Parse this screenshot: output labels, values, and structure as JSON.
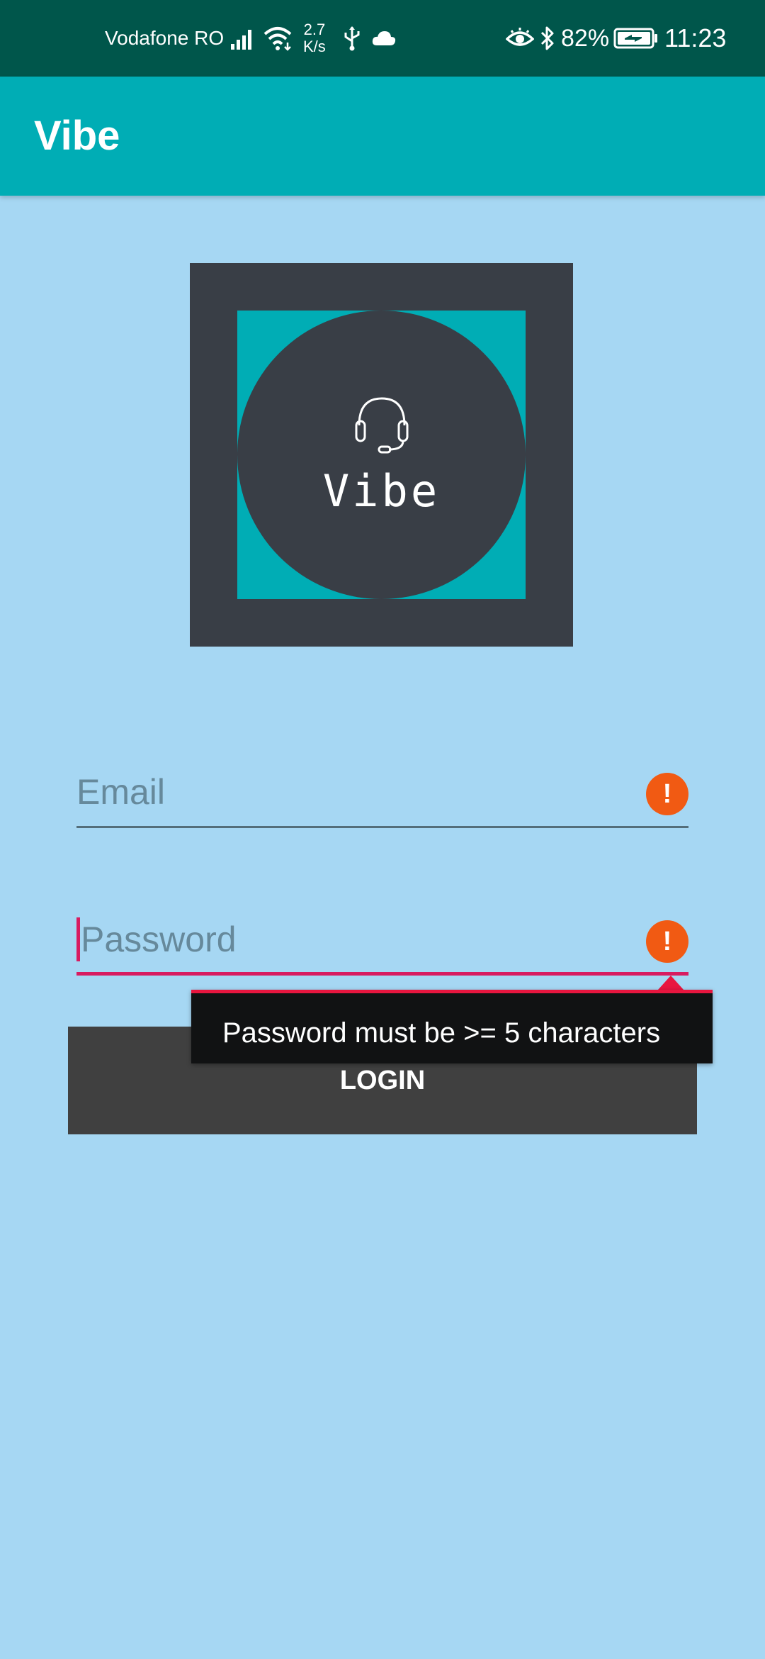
{
  "status_bar": {
    "carrier": "Vodafone RO",
    "net_speed_value": "2.7",
    "net_speed_unit": "K/s",
    "battery_percent": "82%",
    "time": "11:23",
    "icons": [
      "signal-icon",
      "wifi-icon",
      "usb-icon",
      "cloud-icon",
      "eye-icon",
      "bluetooth-icon",
      "battery-icon"
    ]
  },
  "app_bar": {
    "title": "Vibe"
  },
  "logo": {
    "text": "Vibe",
    "icon": "headset-icon"
  },
  "form": {
    "email": {
      "placeholder": "Email",
      "error_icon": "!"
    },
    "password": {
      "placeholder": "Password",
      "error_icon": "!",
      "error_message": "Password must be >= 5 characters"
    },
    "login_label": "LOGIN"
  },
  "colors": {
    "status_bar": "#00564b",
    "app_bar": "#00adb5",
    "background": "#a6d7f3",
    "logo_dark": "#393e46",
    "error_orange": "#f15a13",
    "accent_pink": "#d81b60",
    "button": "#404040"
  }
}
